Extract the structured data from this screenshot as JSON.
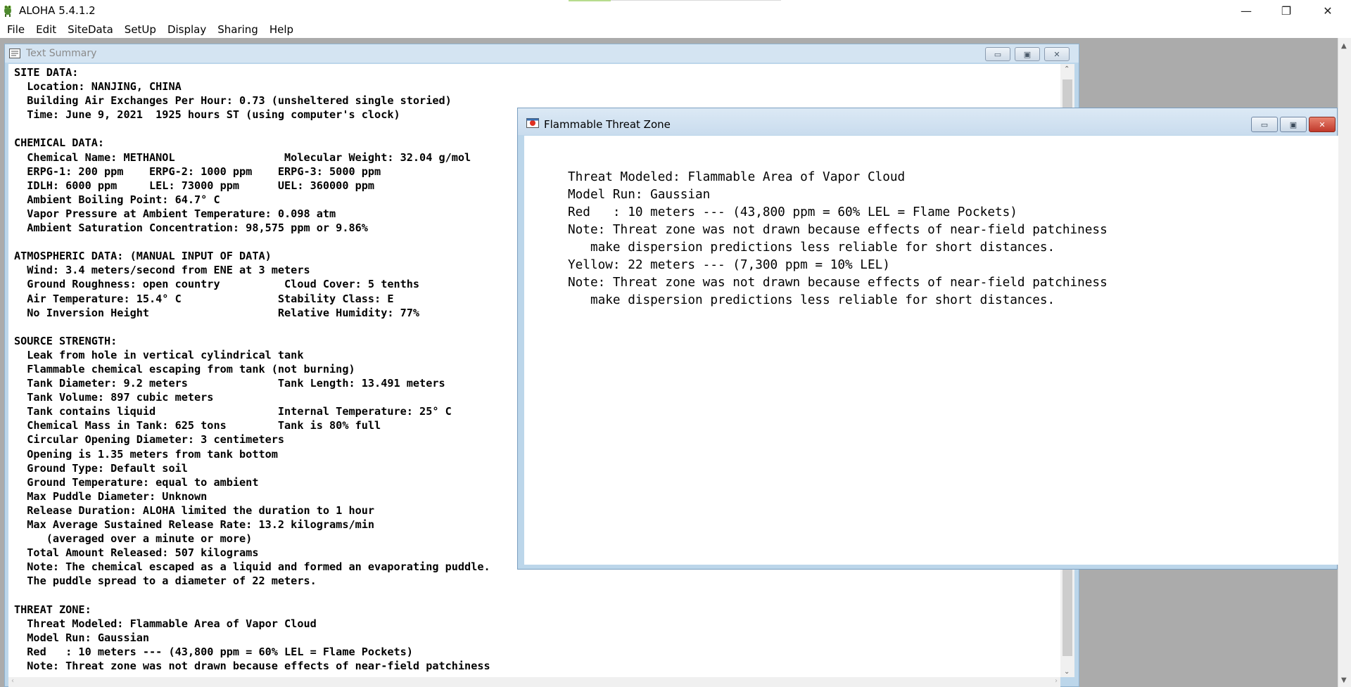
{
  "app": {
    "title": "ALOHA 5.4.1.2",
    "icon": "aloha-frog-icon",
    "accent_color": "#b7dc8e"
  },
  "window_controls": {
    "minimize": "—",
    "maximize": "❐",
    "close": "✕"
  },
  "menu": [
    "File",
    "Edit",
    "SiteData",
    "SetUp",
    "Display",
    "Sharing",
    "Help"
  ],
  "text_summary": {
    "title": "Text Summary",
    "lines": [
      "SITE DATA:",
      "  Location: NANJING, CHINA",
      "  Building Air Exchanges Per Hour: 0.73 (unsheltered single storied)",
      "  Time: June 9, 2021  1925 hours ST (using computer's clock)",
      "",
      "CHEMICAL DATA:",
      "  Chemical Name: METHANOL                 Molecular Weight: 32.04 g/mol",
      "  ERPG-1: 200 ppm    ERPG-2: 1000 ppm    ERPG-3: 5000 ppm",
      "  IDLH: 6000 ppm     LEL: 73000 ppm      UEL: 360000 ppm",
      "  Ambient Boiling Point: 64.7° C",
      "  Vapor Pressure at Ambient Temperature: 0.098 atm",
      "  Ambient Saturation Concentration: 98,575 ppm or 9.86%",
      "",
      "ATMOSPHERIC DATA: (MANUAL INPUT OF DATA)",
      "  Wind: 3.4 meters/second from ENE at 3 meters",
      "  Ground Roughness: open country          Cloud Cover: 5 tenths",
      "  Air Temperature: 15.4° C               Stability Class: E",
      "  No Inversion Height                    Relative Humidity: 77%",
      "",
      "SOURCE STRENGTH:",
      "  Leak from hole in vertical cylindrical tank",
      "  Flammable chemical escaping from tank (not burning)",
      "  Tank Diameter: 9.2 meters              Tank Length: 13.491 meters",
      "  Tank Volume: 897 cubic meters",
      "  Tank contains liquid                   Internal Temperature: 25° C",
      "  Chemical Mass in Tank: 625 tons        Tank is 80% full",
      "  Circular Opening Diameter: 3 centimeters",
      "  Opening is 1.35 meters from tank bottom",
      "  Ground Type: Default soil",
      "  Ground Temperature: equal to ambient",
      "  Max Puddle Diameter: Unknown",
      "  Release Duration: ALOHA limited the duration to 1 hour",
      "  Max Average Sustained Release Rate: 13.2 kilograms/min",
      "     (averaged over a minute or more)",
      "  Total Amount Released: 507 kilograms",
      "  Note: The chemical escaped as a liquid and formed an evaporating puddle.",
      "  The puddle spread to a diameter of 22 meters.",
      "",
      "THREAT ZONE:",
      "  Threat Modeled: Flammable Area of Vapor Cloud",
      "  Model Run: Gaussian",
      "  Red   : 10 meters --- (43,800 ppm = 60% LEL = Flame Pockets)",
      "  Note: Threat zone was not drawn because effects of near-field patchiness"
    ]
  },
  "threat_zone": {
    "title": "Flammable Threat Zone",
    "lines": [
      "Threat Modeled: Flammable Area of Vapor Cloud",
      "Model Run: Gaussian",
      "Red   : 10 meters --- (43,800 ppm = 60% LEL = Flame Pockets)",
      "Note: Threat zone was not drawn because effects of near-field patchiness",
      "   make dispersion predictions less reliable for short distances.",
      "Yellow: 22 meters --- (7,300 ppm = 10% LEL)",
      "Note: Threat zone was not drawn because effects of near-field patchiness",
      "   make dispersion predictions less reliable for short distances."
    ]
  }
}
